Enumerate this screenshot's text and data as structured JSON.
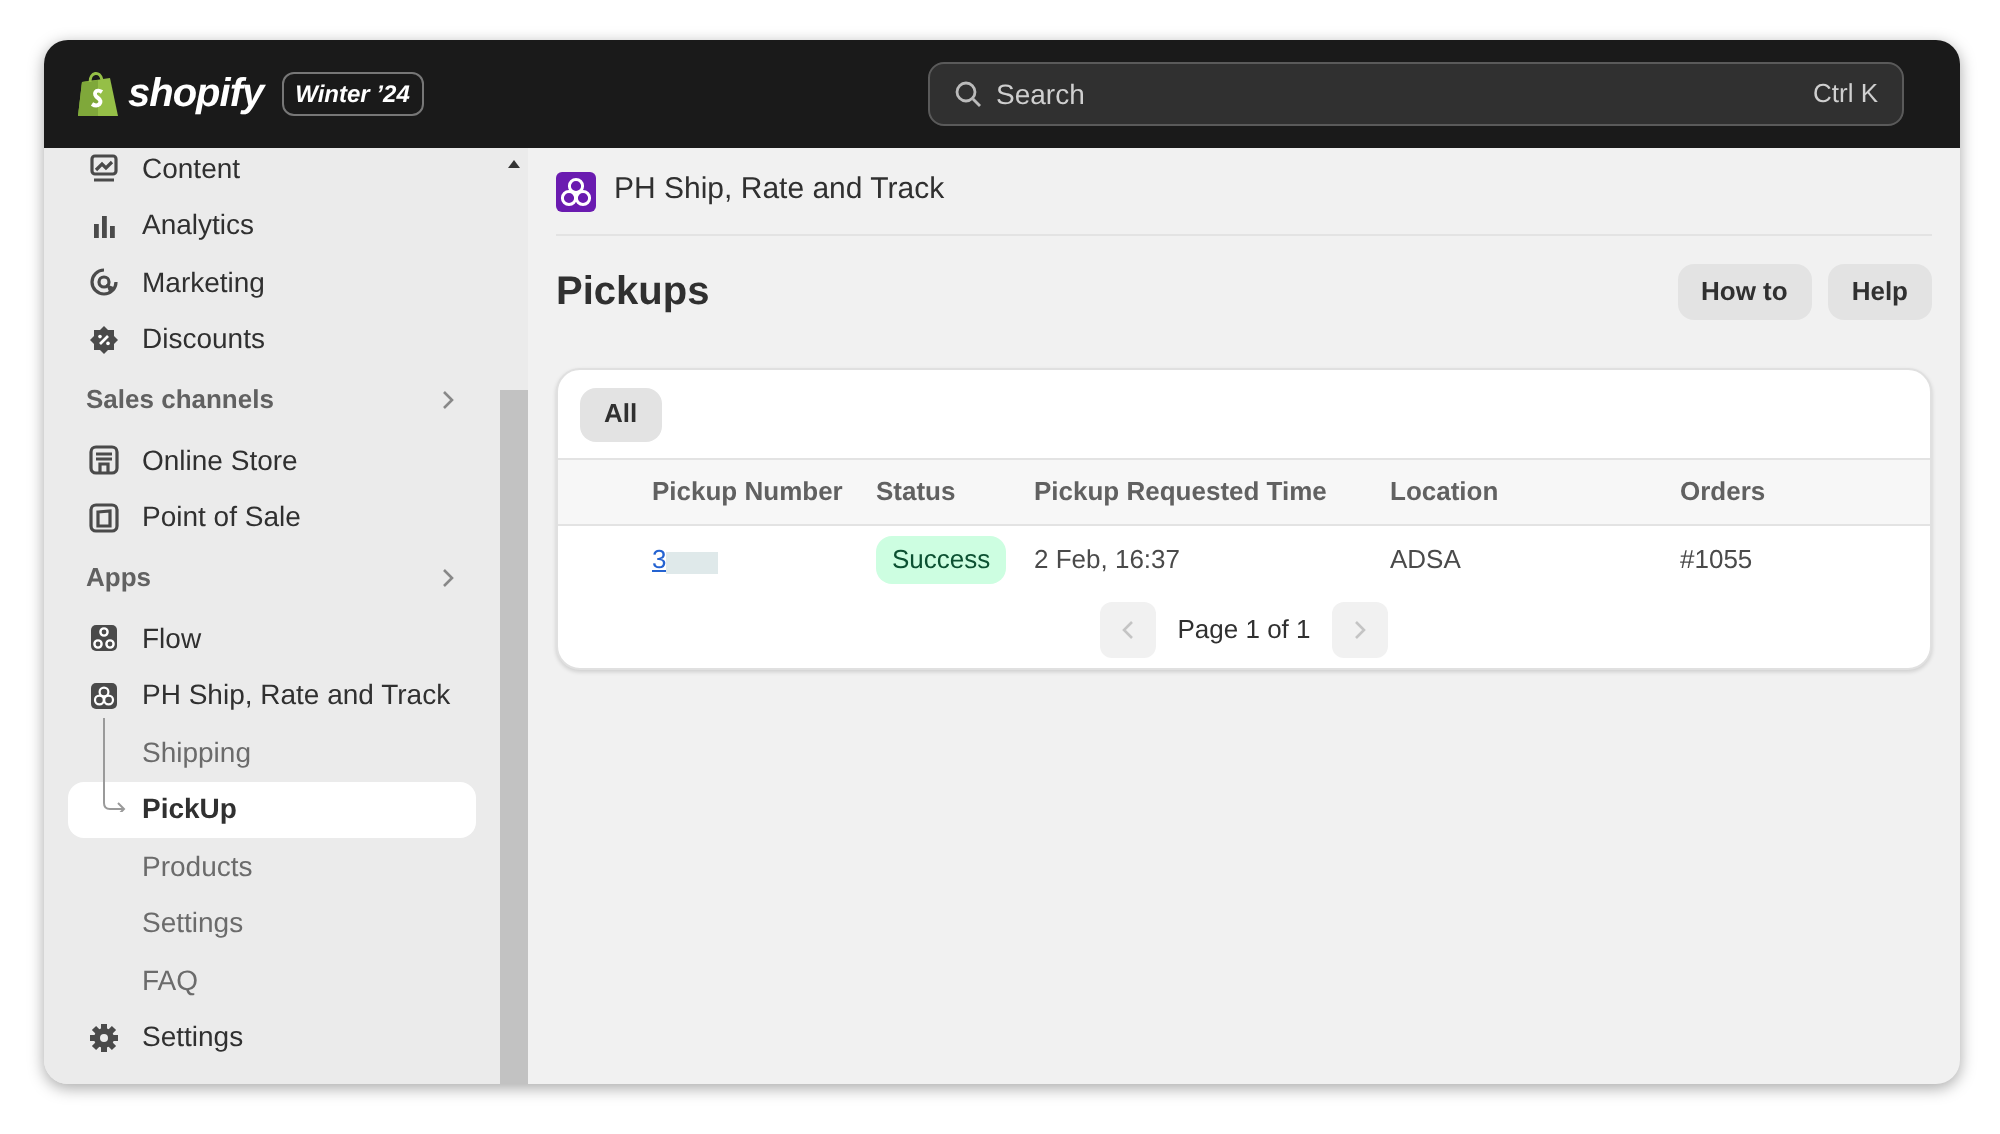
{
  "topbar": {
    "brand": "shopify",
    "edition": "Winter ’24",
    "search": {
      "placeholder": "Search",
      "shortcut": "Ctrl K"
    }
  },
  "sidebar": {
    "items": [
      {
        "kind": "item",
        "label": "Content",
        "selected": false
      },
      {
        "kind": "item",
        "label": "Analytics",
        "selected": false
      },
      {
        "kind": "item",
        "label": "Marketing",
        "selected": false
      },
      {
        "kind": "item",
        "label": "Discounts",
        "selected": false
      },
      {
        "kind": "heading",
        "label": "Sales channels"
      },
      {
        "kind": "item",
        "label": "Online Store",
        "selected": false
      },
      {
        "kind": "item",
        "label": "Point of Sale",
        "selected": false
      },
      {
        "kind": "heading",
        "label": "Apps"
      },
      {
        "kind": "item",
        "label": "Flow",
        "selected": false
      },
      {
        "kind": "item",
        "label": "PH Ship, Rate and Track",
        "selected": false,
        "children": [
          {
            "label": "Shipping",
            "selected": false
          },
          {
            "label": "PickUp",
            "selected": true
          },
          {
            "label": "Products",
            "selected": false
          },
          {
            "label": "Settings",
            "selected": false
          },
          {
            "label": "FAQ",
            "selected": false
          }
        ]
      },
      {
        "kind": "item",
        "label": "Settings",
        "selected": false
      }
    ]
  },
  "app_header": {
    "title": "PH Ship, Rate and Track"
  },
  "page": {
    "title": "Pickups",
    "buttons": [
      "How to",
      "Help"
    ]
  },
  "card": {
    "tabs": [
      {
        "label": "All",
        "selected": true
      }
    ],
    "table": {
      "columns": [
        "Pickup Number",
        "Status",
        "Pickup Requested Time",
        "Location",
        "Orders"
      ],
      "rows": [
        {
          "pickup_number": "3",
          "redacted": true,
          "status": "Success",
          "requested_time": "2 Feb, 16:37",
          "location": "ADSA",
          "orders": "#1055"
        }
      ]
    },
    "pagination": {
      "label": "Page 1 of 1",
      "prev_disabled": true,
      "next_disabled": true
    }
  }
}
